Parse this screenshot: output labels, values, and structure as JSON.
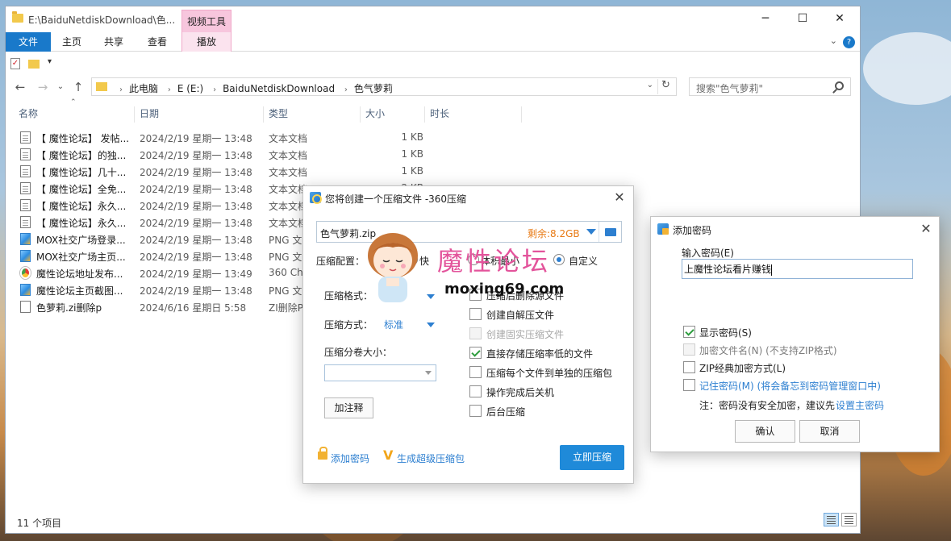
{
  "explorer": {
    "title_path": "E:\\BaiduNetdiskDownload\\色...",
    "ctx_group": "视频工具",
    "ribbon_tabs": [
      "文件",
      "主页",
      "共享",
      "查看",
      "播放"
    ],
    "addr": {
      "crumbs": [
        "此电脑",
        "E (E:)",
        "BaiduNetdiskDownload",
        "色气萝莉"
      ]
    },
    "search_placeholder": "搜索\"色气萝莉\"",
    "columns": [
      "名称",
      "日期",
      "类型",
      "大小",
      "时长"
    ],
    "files": [
      {
        "name": "【 魔性论坛】 发帖...",
        "date": "2024/2/19 星期一 13:48",
        "type": "文本文档",
        "size": "1 KB",
        "icon": "txt"
      },
      {
        "name": "【 魔性论坛】的独...",
        "date": "2024/2/19 星期一 13:48",
        "type": "文本文档",
        "size": "1 KB",
        "icon": "txt"
      },
      {
        "name": "【 魔性论坛】几十...",
        "date": "2024/2/19 星期一 13:48",
        "type": "文本文档",
        "size": "1 KB",
        "icon": "txt"
      },
      {
        "name": "【 魔性论坛】全免...",
        "date": "2024/2/19 星期一 13:48",
        "type": "文本文档",
        "size": "2 KB",
        "icon": "txt"
      },
      {
        "name": "【 魔性论坛】永久...",
        "date": "2024/2/19 星期一 13:48",
        "type": "文本文档",
        "size": "",
        "icon": "txt"
      },
      {
        "name": "【 魔性论坛】永久...",
        "date": "2024/2/19 星期一 13:48",
        "type": "文本文档",
        "size": "",
        "icon": "txt"
      },
      {
        "name": "MOX社交广场登录...",
        "date": "2024/2/19 星期一 13:48",
        "type": "PNG 文",
        "size": "",
        "icon": "png"
      },
      {
        "name": "MOX社交广场主页...",
        "date": "2024/2/19 星期一 13:48",
        "type": "PNG 文",
        "size": "",
        "icon": "png"
      },
      {
        "name": "魔性论坛地址发布...",
        "date": "2024/2/19 星期一 13:49",
        "type": "360 Chr",
        "size": "",
        "icon": "html"
      },
      {
        "name": "魔性论坛主页截图...",
        "date": "2024/2/19 星期一 13:48",
        "type": "PNG 文",
        "size": "",
        "icon": "png"
      },
      {
        "name": "色萝莉.zi删除p",
        "date": "2024/6/16 星期日 5:58",
        "type": "ZI删除P",
        "size": "",
        "icon": "plain"
      }
    ],
    "status": "11 个项目"
  },
  "dialog360": {
    "title": "您将创建一个压缩文件 -360压缩",
    "zip_name": "色气萝莉.zip",
    "remaining": "剩余:8.2GB",
    "config_label": "压缩配置：",
    "config_options": [
      "快",
      "体积最小",
      "自定义"
    ],
    "format_label": "压缩格式：",
    "method_label": "压缩方式：",
    "method_value": "标准",
    "volume_label": "压缩分卷大小：",
    "note_button": "加注释",
    "options": [
      {
        "label": "压缩后删除源文件",
        "checked": false,
        "disabled": false
      },
      {
        "label": "创建自解压文件",
        "checked": false,
        "disabled": false
      },
      {
        "label": "创建固实压缩文件",
        "checked": false,
        "disabled": true
      },
      {
        "label": "直接存储压缩率低的文件",
        "checked": true,
        "disabled": false
      },
      {
        "label": "压缩每个文件到单独的压缩包",
        "checked": false,
        "disabled": false
      },
      {
        "label": "操作完成后关机",
        "checked": false,
        "disabled": false
      },
      {
        "label": "后台压缩",
        "checked": false,
        "disabled": false
      }
    ],
    "add_password_link": "添加密码",
    "super_zip_link": "生成超级压缩包",
    "compress_button": "立即压缩"
  },
  "watermark": {
    "title": "魔性论坛",
    "url": "moxing69.com"
  },
  "password_dialog": {
    "title": "添加密码",
    "input_label": "输入密码(E)",
    "input_value": "上魔性论坛看片赚钱",
    "options": [
      {
        "label": "显示密码(S)",
        "checked": true,
        "disabled": false
      },
      {
        "label": "加密文件名(N) (不支持ZIP格式)",
        "checked": false,
        "disabled": true
      },
      {
        "label": "ZIP经典加密方式(L)",
        "checked": false,
        "disabled": false
      }
    ],
    "remember_link": "记住密码(M) (将会备忘到密码管理窗口中)",
    "note_prefix": "注：密码没有安全加密，建议先",
    "note_link": "设置主密码",
    "ok_button": "确认",
    "cancel_button": "取消"
  },
  "colors": {
    "accent": "#1f8ad9",
    "remaining": "#e87a14",
    "watermark_pink": "#e3539b"
  }
}
